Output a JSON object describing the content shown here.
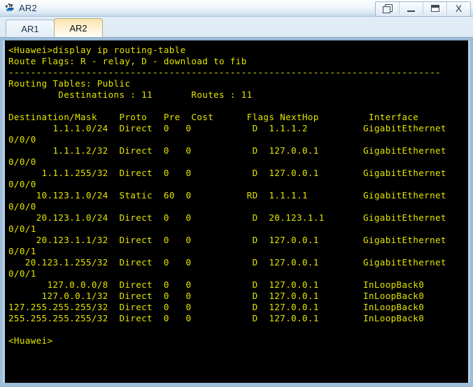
{
  "window": {
    "title": "AR2",
    "icon": "router-icon",
    "controls": [
      {
        "name": "restore-button",
        "label": "",
        "icon": "restore-icon"
      },
      {
        "name": "minimize-button",
        "label": "",
        "icon": "minimize-icon"
      },
      {
        "name": "maximize-button",
        "label": "",
        "icon": "maximize-icon"
      },
      {
        "name": "close-button",
        "label": "X",
        "icon": "close-icon"
      }
    ]
  },
  "tabs": [
    {
      "label": "AR1",
      "active": false
    },
    {
      "label": "AR2",
      "active": true
    }
  ],
  "terminal": {
    "foreground": "#e3e300",
    "background": "#000000",
    "prompt_command": "<Huawei>display ip routing-table",
    "route_flags": "Route Flags: R - relay, D - download to fib",
    "separator": "------------------------------------------------------------------------------",
    "routing_tables_label": "Routing Tables: Public",
    "summary": "         Destinations : 11       Routes : 11",
    "header": "Destination/Mask    Proto   Pre  Cost      Flags NextHop         Interface",
    "columns": [
      "Destination/Mask",
      "Proto",
      "Pre",
      "Cost",
      "Flags",
      "NextHop",
      "Interface"
    ],
    "destinations_count": "11",
    "routes_count": "11",
    "routes": [
      {
        "destination": "1.1.1.0/24",
        "proto": "Direct",
        "pre": "0",
        "cost": "0",
        "flags": "D",
        "nexthop": "1.1.1.2",
        "interface": "GigabitEthernet",
        "interface_cont": "0/0/0"
      },
      {
        "destination": "1.1.1.2/32",
        "proto": "Direct",
        "pre": "0",
        "cost": "0",
        "flags": "D",
        "nexthop": "127.0.0.1",
        "interface": "GigabitEthernet",
        "interface_cont": "0/0/0"
      },
      {
        "destination": "1.1.1.255/32",
        "proto": "Direct",
        "pre": "0",
        "cost": "0",
        "flags": "D",
        "nexthop": "127.0.0.1",
        "interface": "GigabitEthernet",
        "interface_cont": "0/0/0"
      },
      {
        "destination": "10.123.1.0/24",
        "proto": "Static",
        "pre": "60",
        "cost": "0",
        "flags": "RD",
        "nexthop": "1.1.1.1",
        "interface": "GigabitEthernet",
        "interface_cont": "0/0/0"
      },
      {
        "destination": "20.123.1.0/24",
        "proto": "Direct",
        "pre": "0",
        "cost": "0",
        "flags": "D",
        "nexthop": "20.123.1.1",
        "interface": "GigabitEthernet",
        "interface_cont": "0/0/1"
      },
      {
        "destination": "20.123.1.1/32",
        "proto": "Direct",
        "pre": "0",
        "cost": "0",
        "flags": "D",
        "nexthop": "127.0.0.1",
        "interface": "GigabitEthernet",
        "interface_cont": "0/0/1"
      },
      {
        "destination": "20.123.1.255/32",
        "proto": "Direct",
        "pre": "0",
        "cost": "0",
        "flags": "D",
        "nexthop": "127.0.0.1",
        "interface": "GigabitEthernet",
        "interface_cont": "0/0/1"
      },
      {
        "destination": "127.0.0.0/8",
        "proto": "Direct",
        "pre": "0",
        "cost": "0",
        "flags": "D",
        "nexthop": "127.0.0.1",
        "interface": "InLoopBack0",
        "interface_cont": ""
      },
      {
        "destination": "127.0.0.1/32",
        "proto": "Direct",
        "pre": "0",
        "cost": "0",
        "flags": "D",
        "nexthop": "127.0.0.1",
        "interface": "InLoopBack0",
        "interface_cont": ""
      },
      {
        "destination": "127.255.255.255/32",
        "proto": "Direct",
        "pre": "0",
        "cost": "0",
        "flags": "D",
        "nexthop": "127.0.0.1",
        "interface": "InLoopBack0",
        "interface_cont": ""
      },
      {
        "destination": "255.255.255.255/32",
        "proto": "Direct",
        "pre": "0",
        "cost": "0",
        "flags": "D",
        "nexthop": "127.0.0.1",
        "interface": "InLoopBack0",
        "interface_cont": ""
      }
    ],
    "final_prompt": "<Huawei>"
  }
}
